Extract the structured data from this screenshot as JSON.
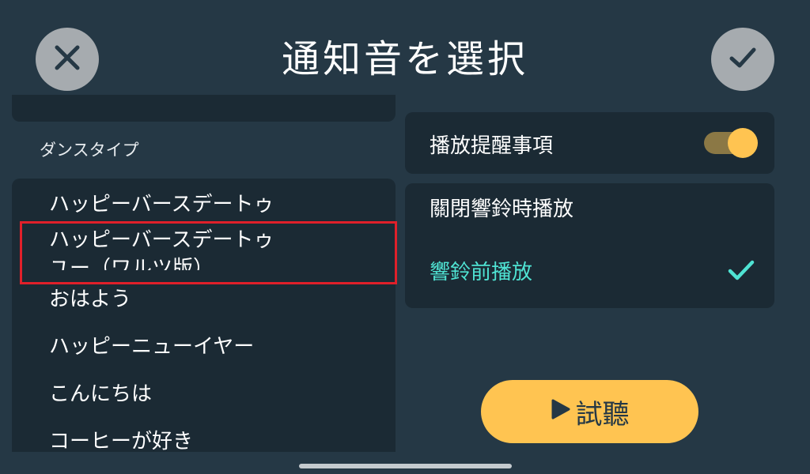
{
  "header": {
    "title": "通知音を選択",
    "close_icon": "close-icon",
    "confirm_icon": "checkmark-icon"
  },
  "sound_list": {
    "section_label": "ダンスタイプ",
    "items": [
      {
        "label": "ハッピーバースデートゥ"
      },
      {
        "label": "ハッピーバースデートゥ ユー（ワルツ版）",
        "line1": "ハッピーバースデートゥ",
        "line2": "ユー（ワルツ版）"
      },
      {
        "label": "おはよう"
      },
      {
        "label": "ハッピーニューイヤー"
      },
      {
        "label": "こんにちは"
      },
      {
        "label": "コーヒーが好き"
      }
    ]
  },
  "reminder": {
    "label": "播放提醒事項",
    "toggle_on": true
  },
  "timing": {
    "options": [
      {
        "label": "關閉響鈴時播放",
        "selected": false
      },
      {
        "label": "響鈴前播放",
        "selected": true
      }
    ]
  },
  "preview_button": {
    "label": "試聽",
    "icon": "play-icon"
  },
  "colors": {
    "background": "#253845",
    "panel": "#1b2a34",
    "accent_yellow": "#ffc451",
    "accent_teal": "#4fe3d3",
    "highlight_red": "#e0202a"
  }
}
